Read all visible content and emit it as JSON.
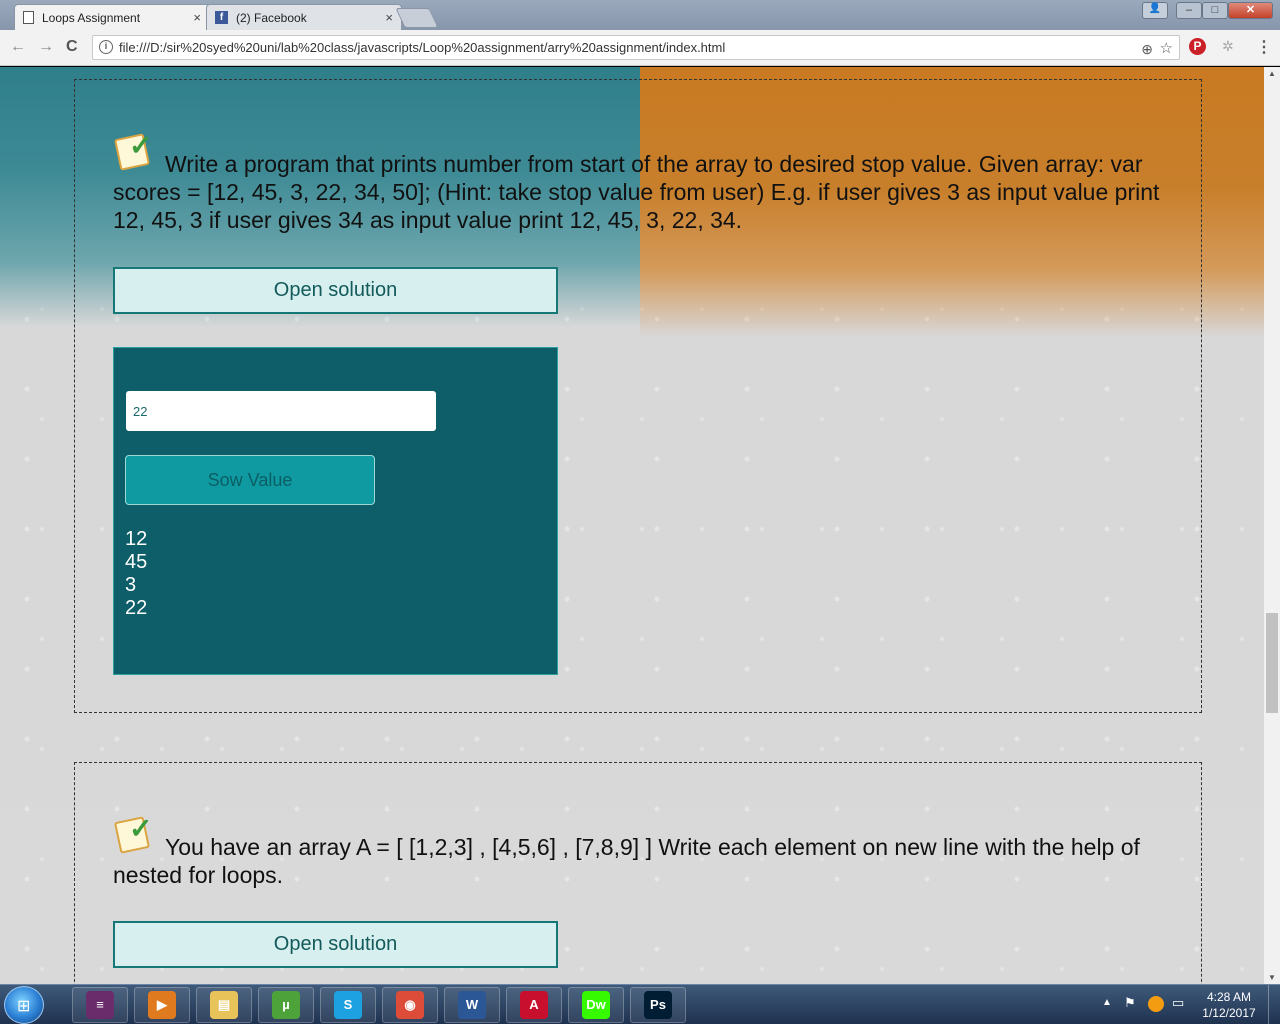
{
  "browser": {
    "tabs": [
      {
        "title": "Loops Assignment",
        "close": "×",
        "active": true
      },
      {
        "title": "(2) Facebook",
        "close": "×",
        "active": false
      }
    ],
    "url": "file:///D:/sir%20syed%20uni/lab%20class/javascripts/Loop%20assignment/arry%20assignment/index.html",
    "window_controls": {
      "minimize": "–",
      "maximize": "□",
      "close": "✕"
    },
    "nav": {
      "back": "←",
      "forward": "→",
      "reload": "C"
    }
  },
  "page": {
    "task1": {
      "text": "Write a program that prints number from start of the array to desired stop value. Given array: var scores = [12, 45, 3, 22, 34, 50]; (Hint: take stop value from user) E.g. if user gives 3 as input value print 12, 45, 3 if user gives 34 as input value print 12, 45, 3, 22, 34.",
      "open_label": "Open solution",
      "input_value": "22",
      "show_label": "Sow Value",
      "output": [
        "12",
        "45",
        "3",
        "22"
      ]
    },
    "task2": {
      "text": "You have an array A = [ [1,2,3] , [4,5,6] , [7,8,9] ] Write each element on new line with the help of nested for loops.",
      "open_label": "Open solution"
    }
  },
  "taskbar": {
    "pinned": [
      {
        "name": "winrar",
        "color": "#6b2c6b",
        "glyph": "≡"
      },
      {
        "name": "media-player",
        "color": "#e07a1f",
        "glyph": "▶"
      },
      {
        "name": "file-explorer",
        "color": "#e8c35a",
        "glyph": "▤"
      },
      {
        "name": "utorrent",
        "color": "#4da33a",
        "glyph": "µ"
      },
      {
        "name": "skype",
        "color": "#1ea1e0",
        "glyph": "S"
      },
      {
        "name": "chrome",
        "color": "#dd4b39",
        "glyph": "◉"
      },
      {
        "name": "word",
        "color": "#2b5797",
        "glyph": "W"
      },
      {
        "name": "acrobat",
        "color": "#c8102e",
        "glyph": "A"
      },
      {
        "name": "dreamweaver",
        "color": "#35fa00",
        "glyph": "Dw"
      },
      {
        "name": "photoshop",
        "color": "#001d34",
        "glyph": "Ps"
      }
    ],
    "time": "4:28 AM",
    "date": "1/12/2017"
  }
}
